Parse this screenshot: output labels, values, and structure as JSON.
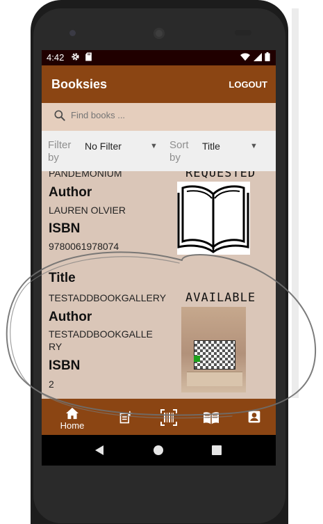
{
  "status_bar": {
    "time": "4:42",
    "left_icons": [
      "gear-icon",
      "sd-card-icon"
    ],
    "right_icons": [
      "wifi-icon",
      "signal-icon",
      "battery-icon"
    ]
  },
  "app_bar": {
    "title": "Booksies",
    "logout_label": "LOGOUT"
  },
  "search": {
    "placeholder": "Find books ..."
  },
  "filter_bar": {
    "filter_label": "Filter by",
    "filter_value": "No Filter",
    "sort_label": "Sort by",
    "sort_value": "Title"
  },
  "books": [
    {
      "title_label": "Title",
      "title": "PANDEMONIUM",
      "status": "REQUESTED",
      "author_label": "Author",
      "author": "LAUREN OLVIER",
      "isbn_label": "ISBN",
      "isbn": "9780061978074"
    },
    {
      "title_label": "Title",
      "title": "TESTADDBOOKGALLERY",
      "status": "AVAILABLE",
      "author_label": "Author",
      "author_lines": [
        "TESTADDBOOKGALLE",
        "RY"
      ],
      "isbn_label": "ISBN",
      "isbn": "2"
    }
  ],
  "bottom_nav": {
    "items": [
      {
        "icon": "home-icon",
        "label": "Home",
        "active": true
      },
      {
        "icon": "add-book-icon"
      },
      {
        "icon": "barcode-scan-icon"
      },
      {
        "icon": "open-book-icon"
      },
      {
        "icon": "account-box-icon"
      }
    ]
  },
  "colors": {
    "brand": "#8b4513",
    "status_bar": "#200000",
    "list_background": "#dac6b8",
    "search_background": "#e5cebd",
    "filter_background": "#efefef"
  }
}
